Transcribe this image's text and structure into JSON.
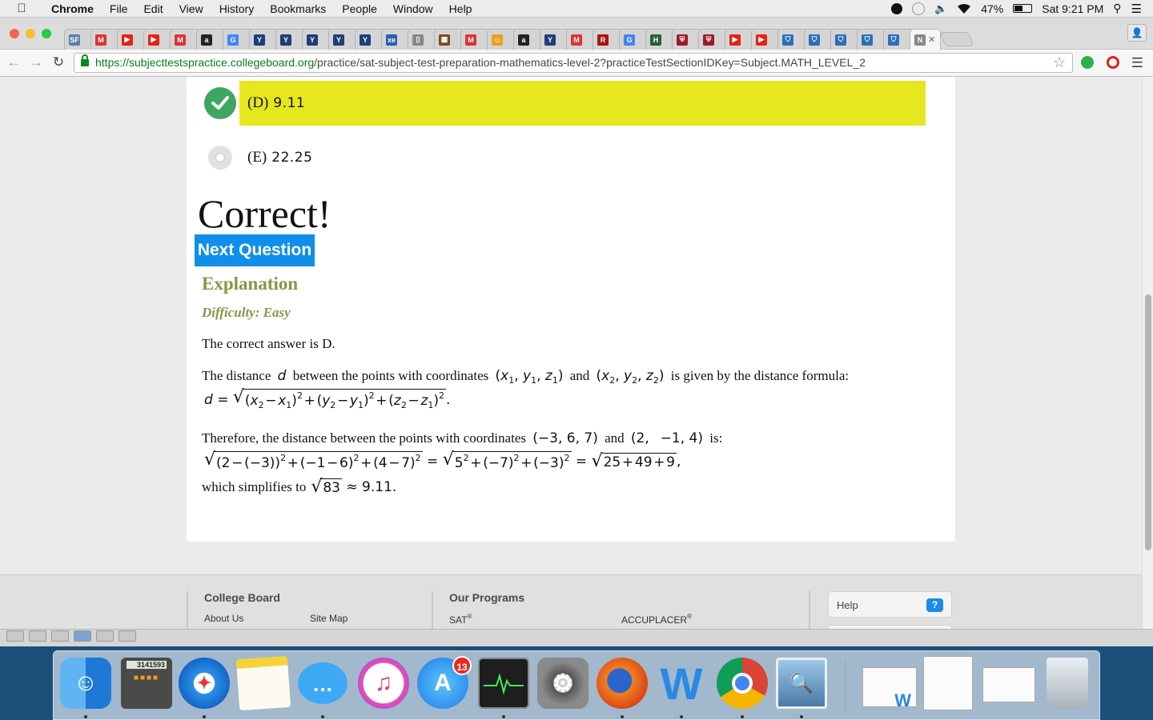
{
  "menubar": {
    "app": "Chrome",
    "items": [
      "File",
      "Edit",
      "View",
      "History",
      "Bookmarks",
      "People",
      "Window",
      "Help"
    ],
    "battery": "47%",
    "clock": "Sat 9:21 PM"
  },
  "browser": {
    "url_host": "https://subjecttestspractice.collegeboard.org",
    "url_path": "/practice/sat-subject-test-preparation-mathematics-level-2?practiceTestSectionIDKey=Subject.MATH_LEVEL_2",
    "tabs": [
      {
        "fav": "SF",
        "color": "#5a7fa8"
      },
      {
        "fav": "M",
        "color": "#d33"
      },
      {
        "fav": "▶",
        "color": "#e62117"
      },
      {
        "fav": "▶",
        "color": "#e62117"
      },
      {
        "fav": "M",
        "color": "#d33"
      },
      {
        "fav": "a",
        "color": "#222"
      },
      {
        "fav": "G",
        "color": "#4285f4"
      },
      {
        "fav": "Y",
        "color": "#1f3d7a"
      },
      {
        "fav": "Y",
        "color": "#1f3d7a"
      },
      {
        "fav": "Y",
        "color": "#1f3d7a"
      },
      {
        "fav": "Y",
        "color": "#1f3d7a"
      },
      {
        "fav": "Y",
        "color": "#1f3d7a"
      },
      {
        "fav": "xe",
        "color": "#2a5fb0"
      },
      {
        "fav": "▯",
        "color": "#888"
      },
      {
        "fav": "▦",
        "color": "#7a4a1e"
      },
      {
        "fav": "M",
        "color": "#d33"
      },
      {
        "fav": "☺",
        "color": "#e9a21b"
      },
      {
        "fav": "a",
        "color": "#222"
      },
      {
        "fav": "Y",
        "color": "#1f3d7a"
      },
      {
        "fav": "M",
        "color": "#d33"
      },
      {
        "fav": "R",
        "color": "#a11"
      },
      {
        "fav": "G",
        "color": "#4285f4"
      },
      {
        "fav": "H",
        "color": "#2d5d3a"
      },
      {
        "fav": "⛨",
        "color": "#9b1b2a"
      },
      {
        "fav": "⛨",
        "color": "#9b1b2a"
      },
      {
        "fav": "▶",
        "color": "#e62117"
      },
      {
        "fav": "▶",
        "color": "#e62117"
      },
      {
        "fav": "⛉",
        "color": "#2c6fb8"
      },
      {
        "fav": "⛉",
        "color": "#2c6fb8"
      },
      {
        "fav": "⛉",
        "color": "#2c6fb8"
      },
      {
        "fav": "⛉",
        "color": "#2c6fb8"
      },
      {
        "fav": "⛉",
        "color": "#2c6fb8"
      }
    ]
  },
  "question": {
    "option_d_label": "(D)",
    "option_d_value": "9.11",
    "option_e_label": "(E)",
    "option_e_value": "22.25",
    "result": "Correct!",
    "next_button": "Next Question",
    "explanation_heading": "Explanation",
    "difficulty": "Difficulty: Easy",
    "answer_text": "The correct answer is D.",
    "p1_a": "The distance",
    "p1_b": "between the points with coordinates",
    "p1_and": "and",
    "p1_c": "is given by the distance formula:",
    "p2_a": "Therefore, the distance between the points with coordinates",
    "p2_and": "and",
    "p2_b": "is:",
    "p3_a": "which simplifies to",
    "final": "≈ 9.11."
  },
  "footer": {
    "col1_title": "College Board",
    "col1_links": [
      "About Us",
      "Site Map"
    ],
    "col2_title": "Our Programs",
    "col2_links": [
      "SAT",
      "ACCUPLACER"
    ],
    "help": "Help",
    "help_icon": "?"
  },
  "dock": {
    "calculator_display": "3141593",
    "appstore_badge": "13",
    "apps": [
      "finder",
      "calculator",
      "safari",
      "notes",
      "messages",
      "itunes",
      "app-store",
      "activity-monitor",
      "system-preferences",
      "firefox",
      "word",
      "chrome",
      "preview"
    ]
  }
}
